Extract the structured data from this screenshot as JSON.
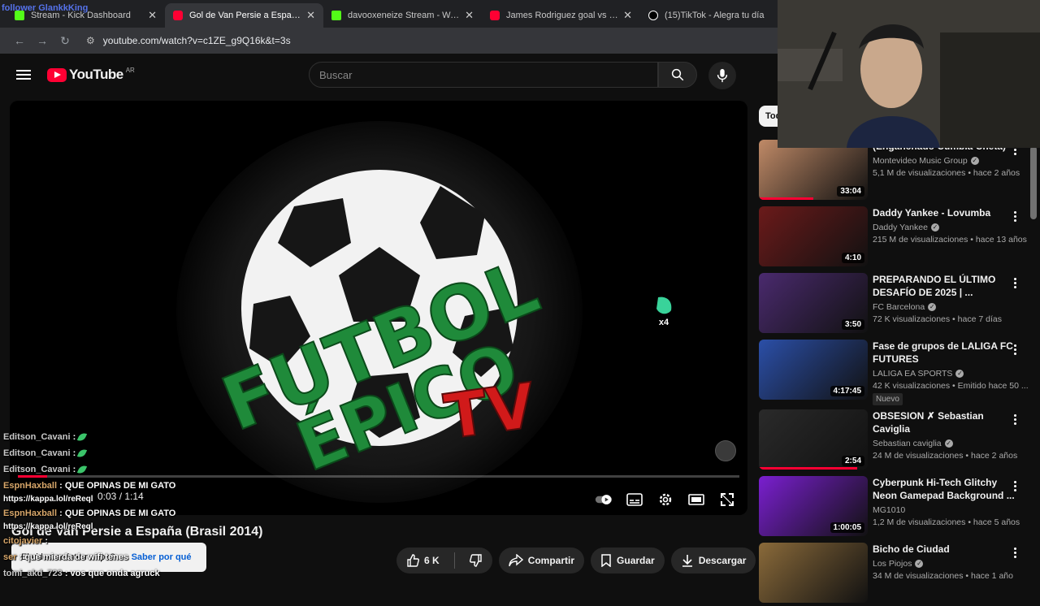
{
  "browser": {
    "overlay_text": "follower GlankkKing",
    "tabs": [
      {
        "label": "Stream - Kick Dashboard",
        "favicon": "kick",
        "active": false
      },
      {
        "label": "Gol de Van Persie a España (Bra",
        "favicon": "youtube",
        "active": true
      },
      {
        "label": "davooxeneize Stream - Watch L",
        "favicon": "kick",
        "active": false
      },
      {
        "label": "James Rodriguez goal vs Urugu",
        "favicon": "youtube",
        "active": false
      },
      {
        "label": "(15)TikTok - Alegra tu día",
        "favicon": "tiktok",
        "active": false
      }
    ],
    "url": "youtube.com/watch?v=c1ZE_g9Q16k&t=3s"
  },
  "header": {
    "logo_text": "YouTube",
    "country_code": "AR",
    "search_placeholder": "Buscar"
  },
  "player": {
    "logo_line1": "FUTBOL",
    "logo_line2": "ÉPICO",
    "logo_line3": "TV",
    "emote_count": "x4",
    "time": "0:03 / 1:14",
    "progress_fraction": 0.04
  },
  "video": {
    "title": "Gol de Van Persie a España (Brasil 2014)",
    "likes": "6 K",
    "share_label": "Compartir",
    "save_label": "Guardar",
    "download_label": "Descargar"
  },
  "toast": {
    "text": "El video se interrumpe?",
    "action": "Saber por qué"
  },
  "chat": [
    {
      "user": "Editson_Cavani",
      "msg": ":",
      "emote": true,
      "style": "g"
    },
    {
      "user": "Editson_Cavani",
      "msg": ":",
      "emote": true,
      "style": "g"
    },
    {
      "user": "Editson_Cavani",
      "msg": ":",
      "emote": true,
      "style": "g"
    },
    {
      "user": "EspnHaxball",
      "msg": ": QUE OPINAS DE MI GATO",
      "link": "https://kappa.lol/reReql",
      "style": ""
    },
    {
      "user": "EspnHaxball",
      "msg": ": QUE OPINAS DE MI GATO",
      "link": "https://kappa.lol/reReql",
      "style": ""
    },
    {
      "user": "citojavier",
      "msg": ":",
      "emote": false,
      "style": ""
    },
    {
      "user": "ser",
      "msg": ": que mierda de wifi tenes",
      "style": ""
    },
    {
      "user": "tomi_akd_723",
      "msg": ": vos que onda agruck",
      "style": "g"
    }
  ],
  "sidebar": {
    "chip_label": "Tod",
    "videos": [
      {
        "title": "(Enganchado Cumbia Cheta)",
        "channel": "Montevideo Music Group",
        "verified": true,
        "views": "5,1 M de visualizaciones",
        "age": "hace 2 años",
        "duration": "33:04",
        "thumb": "#c08a67",
        "watched": 0.5,
        "badge": ""
      },
      {
        "title": "Daddy Yankee - Lovumba",
        "channel": "Daddy Yankee",
        "verified": true,
        "views": "215 M de visualizaciones",
        "age": "hace 13 años",
        "duration": "4:10",
        "thumb": "#6b1a1a",
        "watched": 0,
        "badge": ""
      },
      {
        "title": "PREPARANDO EL ÚLTIMO DESAFÍO DE 2025 | ...",
        "channel": "FC Barcelona",
        "verified": true,
        "views": "72 K visualizaciones",
        "age": "hace 7 días",
        "duration": "3:50",
        "thumb": "#4a2a6e",
        "watched": 0,
        "badge": ""
      },
      {
        "title": "Fase de grupos de LALIGA FC FUTURES",
        "channel": "LALIGA EA SPORTS",
        "verified": true,
        "views": "42 K visualizaciones",
        "age": "Emitido hace 50 ...",
        "duration": "4:17:45",
        "thumb": "#2b4fa8",
        "watched": 0,
        "badge": "Nuevo"
      },
      {
        "title": "OBSESION ✗ Sebastian Caviglia",
        "channel": "Sebastian caviglia",
        "verified": true,
        "views": "24 M de visualizaciones",
        "age": "hace 2 años",
        "duration": "2:54",
        "thumb": "#2a2a2a",
        "watched": 0.9,
        "badge": ""
      },
      {
        "title": "Cyberpunk Hi-Tech Glitchy Neon Gamepad Background ...",
        "channel": "MG1010",
        "verified": false,
        "views": "1,2 M de visualizaciones",
        "age": "hace 5 años",
        "duration": "1:00:05",
        "thumb": "#7a1fd0",
        "watched": 0,
        "badge": ""
      },
      {
        "title": "Bicho de Ciudad",
        "channel": "Los Piojos",
        "verified": true,
        "views": "34 M de visualizaciones",
        "age": "hace 1 año",
        "duration": "",
        "thumb": "#8a6a3a",
        "watched": 0,
        "badge": ""
      }
    ]
  }
}
